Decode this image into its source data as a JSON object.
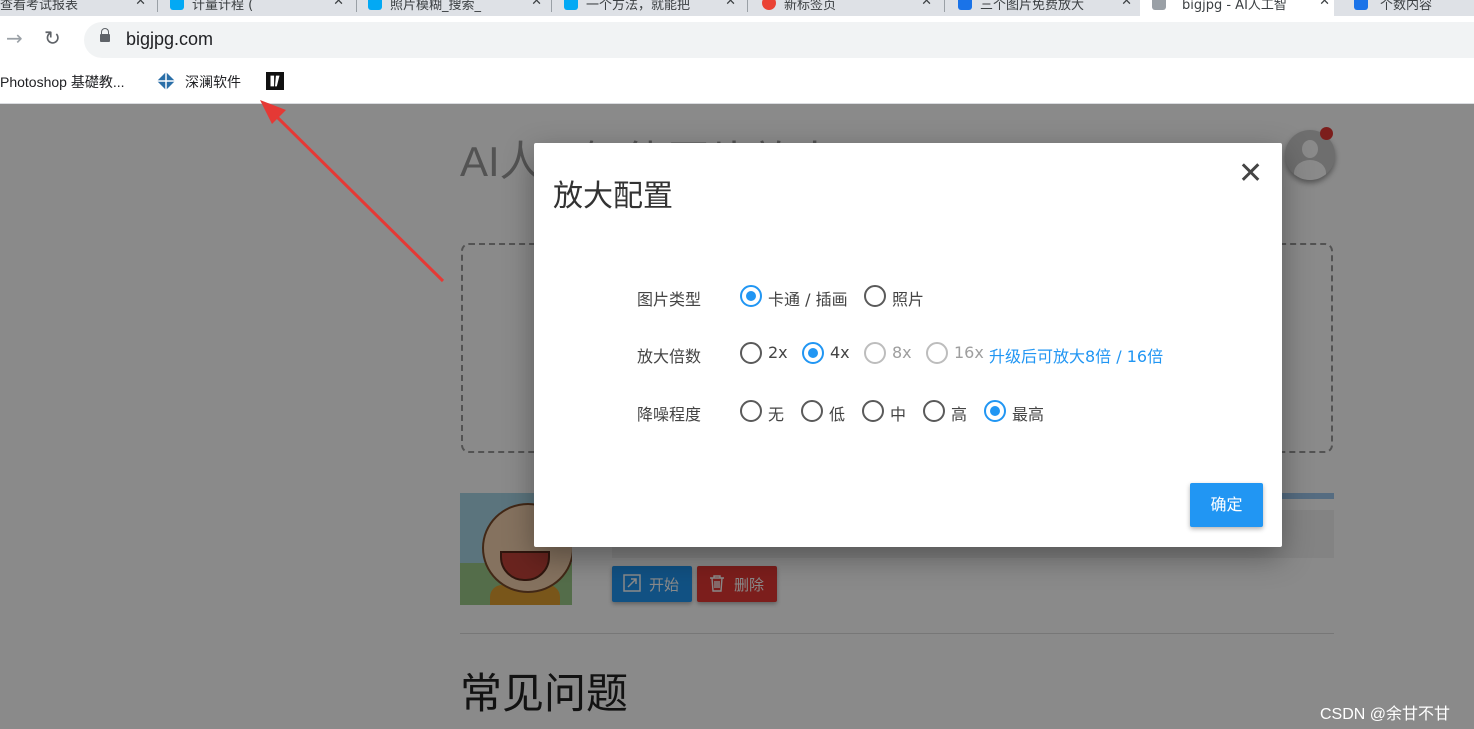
{
  "browser": {
    "tabs": [
      {
        "title": "查看考试报表",
        "color": "#4285f4"
      },
      {
        "title": "计量计程 (",
        "color": "#03a9f4"
      },
      {
        "title": "照片模糊_搜索_",
        "color": "#03a9f4"
      },
      {
        "title": "一个方法，就能把",
        "color": "#03a9f4"
      },
      {
        "title": "新标签页",
        "color": "#ea4335"
      },
      {
        "title": "三个图片免费放大",
        "color": "#1a73e8"
      },
      {
        "title": "bigjpg - AI人工智",
        "color": "#9aa0a6"
      },
      {
        "title": "个数内容",
        "color": "#1a73e8"
      }
    ],
    "url": "bigjpg.com",
    "bookmarks": [
      "Photoshop 基礎教...",
      "深澜软件"
    ]
  },
  "page": {
    "title": "AI人工智能图片放大",
    "buttons": {
      "start": "开始",
      "delete": "删除"
    },
    "faq_title": "常见问题"
  },
  "modal": {
    "title": "放大配置",
    "close": "✕",
    "rows": [
      {
        "label": "图片类型",
        "options": [
          {
            "label": "卡通 / 插画",
            "checked": true,
            "disabled": false
          },
          {
            "label": "照片",
            "checked": false,
            "disabled": false
          }
        ]
      },
      {
        "label": "放大倍数",
        "options": [
          {
            "label": "2x",
            "checked": false,
            "disabled": false
          },
          {
            "label": "4x",
            "checked": true,
            "disabled": false
          },
          {
            "label": "8x",
            "checked": false,
            "disabled": true
          },
          {
            "label": "16x",
            "checked": false,
            "disabled": true
          }
        ],
        "upgrade_link": "升级后可放大8倍 / 16倍"
      },
      {
        "label": "降噪程度",
        "options": [
          {
            "label": "无",
            "checked": false,
            "disabled": false
          },
          {
            "label": "低",
            "checked": false,
            "disabled": false
          },
          {
            "label": "中",
            "checked": false,
            "disabled": false
          },
          {
            "label": "高",
            "checked": false,
            "disabled": false
          },
          {
            "label": "最高",
            "checked": true,
            "disabled": false
          }
        ]
      }
    ],
    "confirm": "确定"
  },
  "watermark": "CSDN @余甘不甘",
  "colors": {
    "accent": "#2196f3",
    "danger": "#e53935",
    "annotation_arrow": "#e53935"
  }
}
